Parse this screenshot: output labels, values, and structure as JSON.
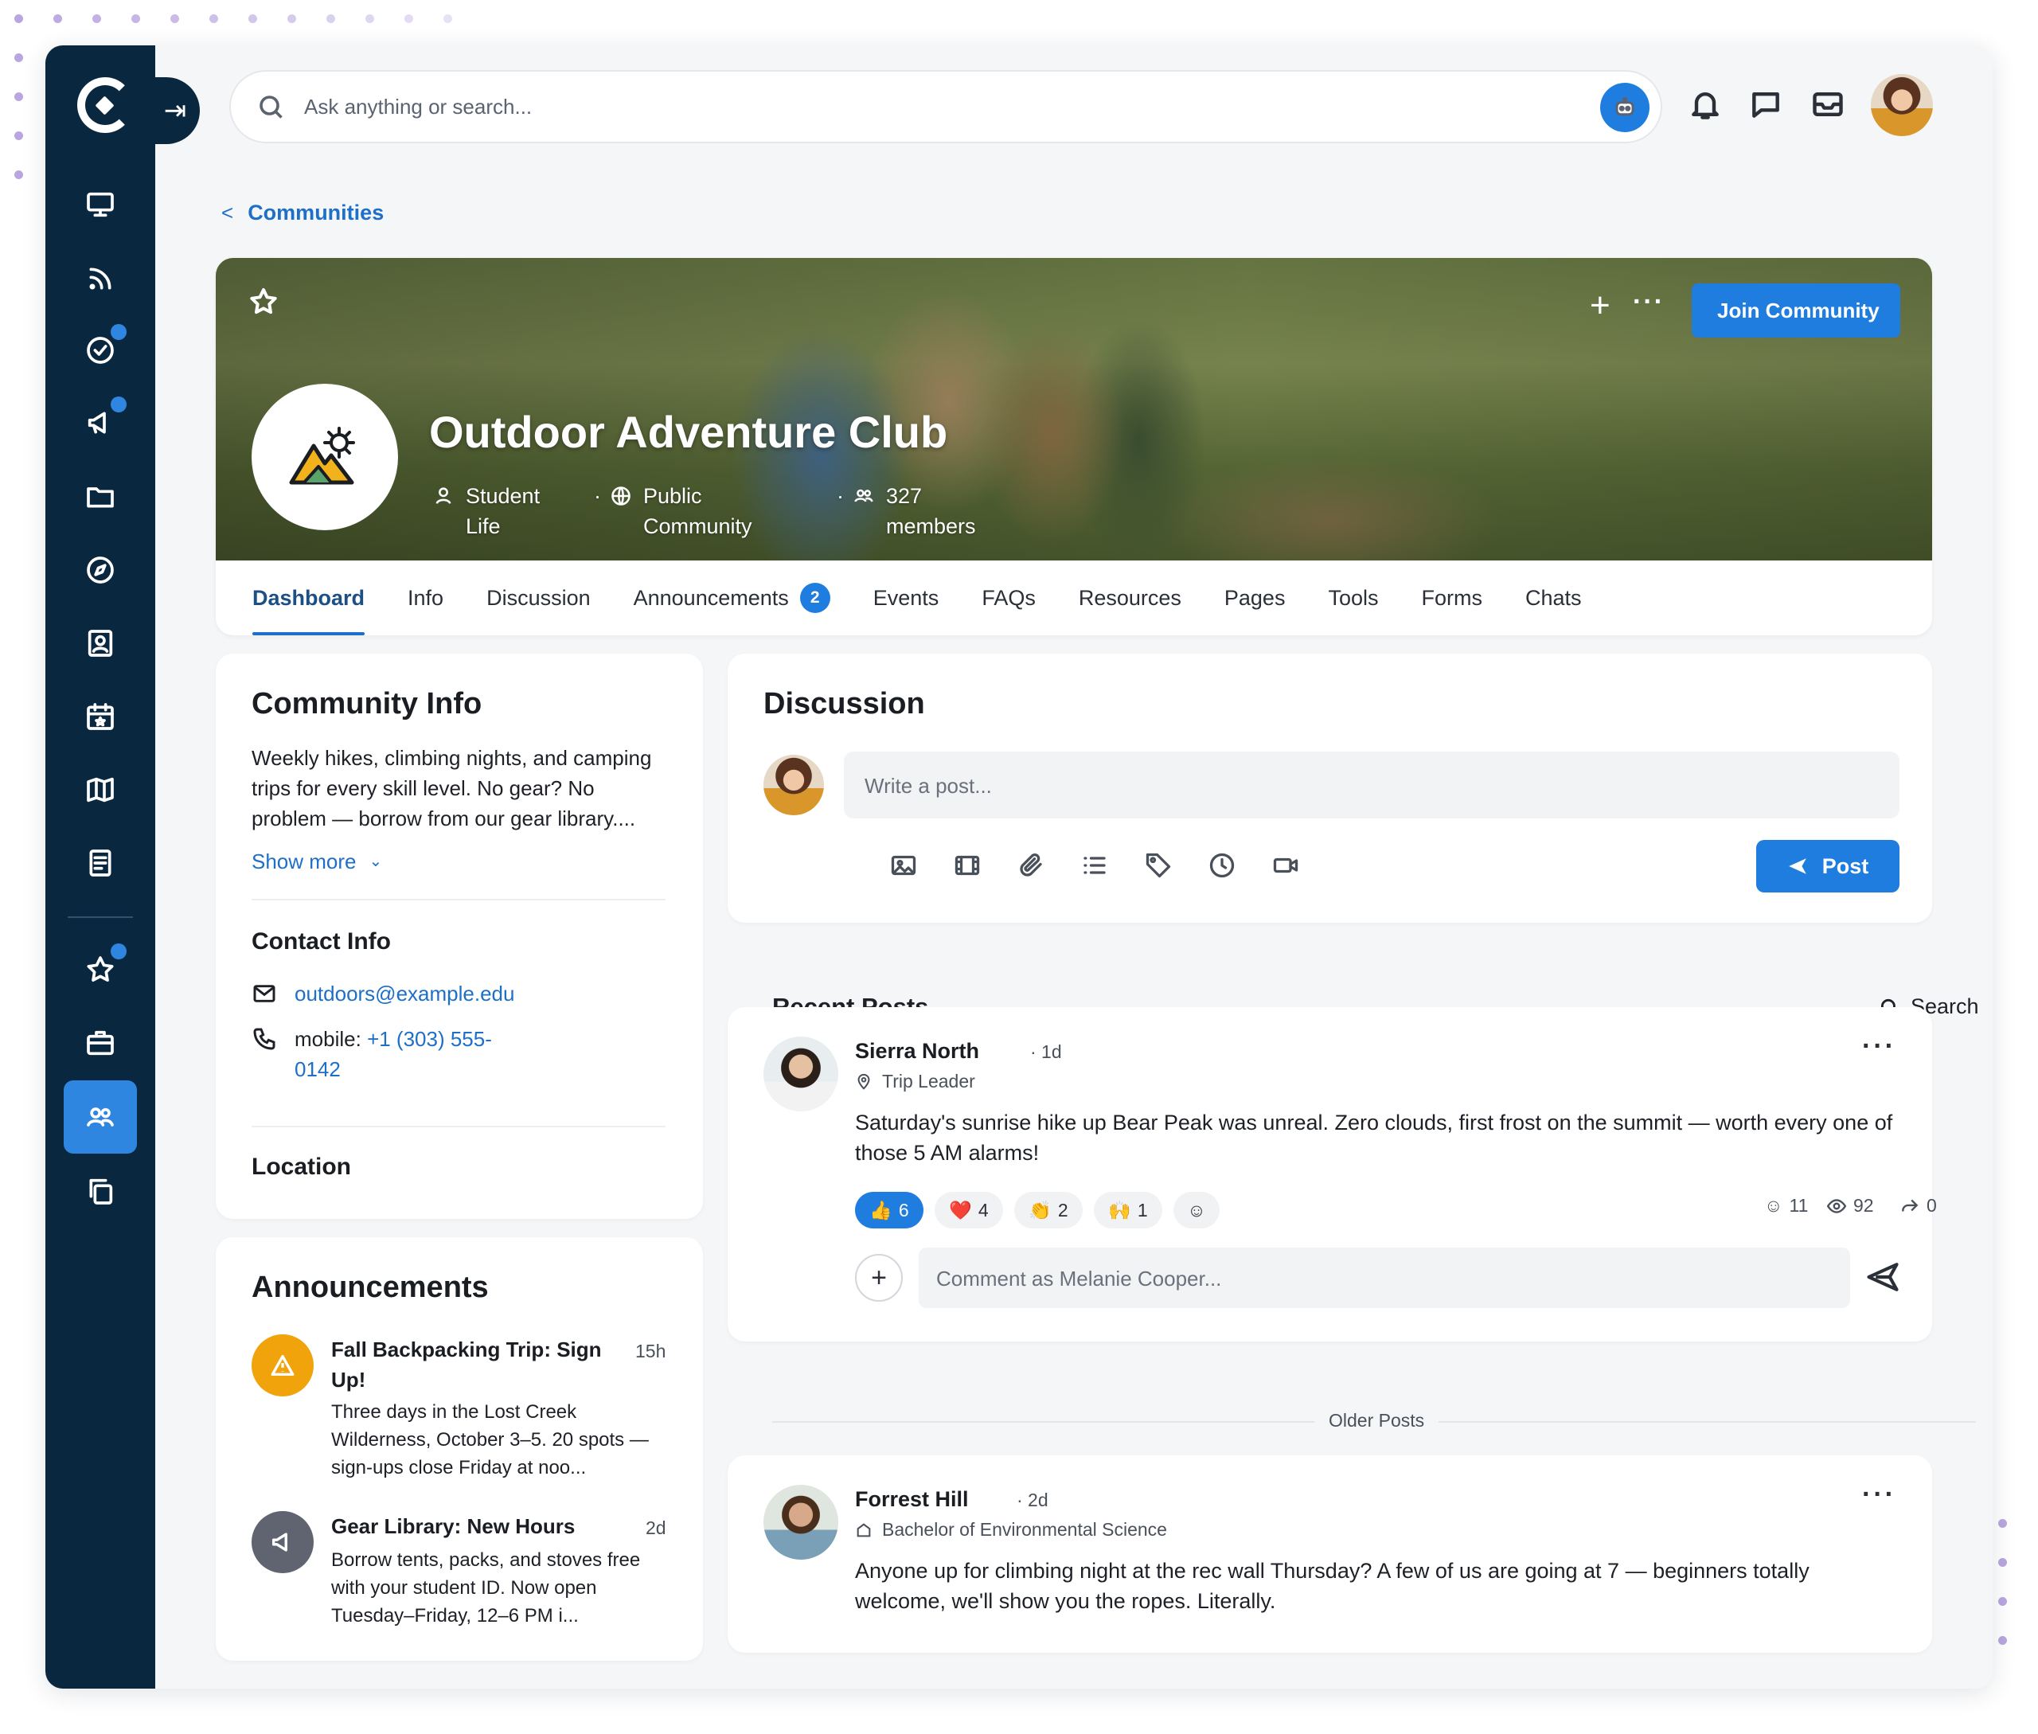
{
  "search": {
    "placeholder": "Ask anything or search..."
  },
  "breadcrumb": {
    "label": "Communities"
  },
  "community": {
    "title": "Outdoor Adventure Club",
    "category": "Student Life",
    "visibility": "Public Community",
    "members": "327 members",
    "join_label": "Join Community"
  },
  "tabs": [
    {
      "label": "Dashboard",
      "active": true
    },
    {
      "label": "Info"
    },
    {
      "label": "Discussion"
    },
    {
      "label": "Announcements",
      "count": "2"
    },
    {
      "label": "Events"
    },
    {
      "label": "FAQs"
    },
    {
      "label": "Resources"
    },
    {
      "label": "Pages"
    },
    {
      "label": "Tools"
    },
    {
      "label": "Forms"
    },
    {
      "label": "Chats"
    }
  ],
  "info": {
    "title": "Community Info",
    "description": "Weekly hikes, climbing nights, and camping trips for every skill level. No gear? No problem — borrow from our gear library....",
    "show_more": "Show more",
    "contact_title": "Contact Info",
    "email": "outdoors@example.edu",
    "phone_label": "mobile:",
    "phone": "+1 (303) 555-0142",
    "location_title": "Location"
  },
  "announcements": {
    "title": "Announcements",
    "items": [
      {
        "title": "Fall Backpacking Trip: Sign Up!",
        "time": "15h",
        "text": "Three days in the Lost Creek Wilderness, October 3–5. 20 spots — sign-ups close Friday at noo...",
        "color": "#f0a30a"
      },
      {
        "title": "Gear Library: New Hours",
        "time": "2d",
        "text": "Borrow tents, packs, and stoves free with your student ID. Now open Tuesday–Friday, 12–6 PM i...",
        "color": "#5f6470"
      }
    ]
  },
  "discussion": {
    "title": "Discussion",
    "placeholder": "Write a post...",
    "post_label": "Post",
    "recent_label": "Recent Posts",
    "search_label": "Search",
    "older_label": "Older Posts",
    "comment_placeholder": "Comment as Melanie Cooper..."
  },
  "posts": [
    {
      "author": "Sierra North",
      "time": "· 1d",
      "role": "Trip Leader",
      "text": "Saturday's sunrise hike up Bear Peak was unreal. Zero clouds, first frost on the summit — worth every one of those 5 AM alarms!",
      "reactions": [
        {
          "emoji": "👍",
          "count": "6",
          "on": true
        },
        {
          "emoji": "❤️",
          "count": "4"
        },
        {
          "emoji": "👏",
          "count": "2"
        },
        {
          "emoji": "🙌",
          "count": "1"
        },
        {
          "emoji": "☺",
          "count": ""
        }
      ],
      "stats": {
        "comments": "11",
        "views": "92",
        "shares": "0"
      }
    },
    {
      "author": "Forrest Hill",
      "time": "· 2d",
      "role": "Bachelor of Environmental Science",
      "text": "Anyone up for climbing night at the rec wall Thursday? A few of us are going at 7 — beginners totally welcome, we'll show you the ropes. Literally."
    }
  ],
  "colors": {
    "sidebar": "#0a2740",
    "accent": "#1f7de0"
  }
}
